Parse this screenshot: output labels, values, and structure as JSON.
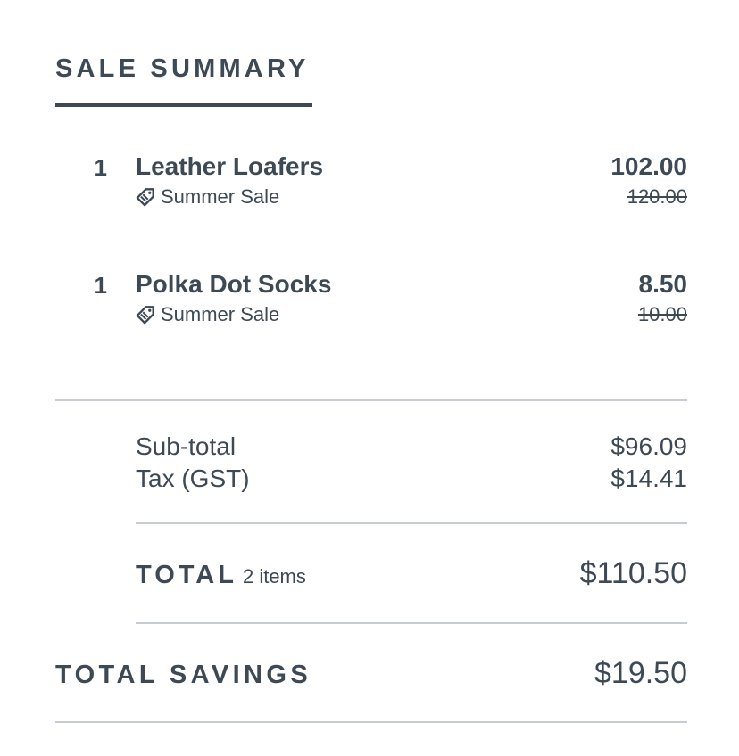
{
  "header": {
    "title": "SALE SUMMARY"
  },
  "items": [
    {
      "quantity": "1",
      "name": "Leather Loafers",
      "promotion": "Summer Sale",
      "promotion_icon": "tag-icon",
      "price": "102.00",
      "original_price": "120.00"
    },
    {
      "quantity": "1",
      "name": "Polka Dot Socks",
      "promotion": "Summer Sale",
      "promotion_icon": "tag-icon",
      "price": "8.50",
      "original_price": "10.00"
    }
  ],
  "summary": {
    "subtotal_label": "Sub-total",
    "subtotal_value": "$96.09",
    "tax_label": "Tax (GST)",
    "tax_value": "$14.41",
    "total_label": "TOTAL",
    "total_items": "2 items",
    "total_value": "$110.50",
    "savings_label": "TOTAL SAVINGS",
    "savings_value": "$19.50"
  },
  "colors": {
    "text": "#3d4a55",
    "divider": "#c6ccd1",
    "background": "#ffffff"
  }
}
